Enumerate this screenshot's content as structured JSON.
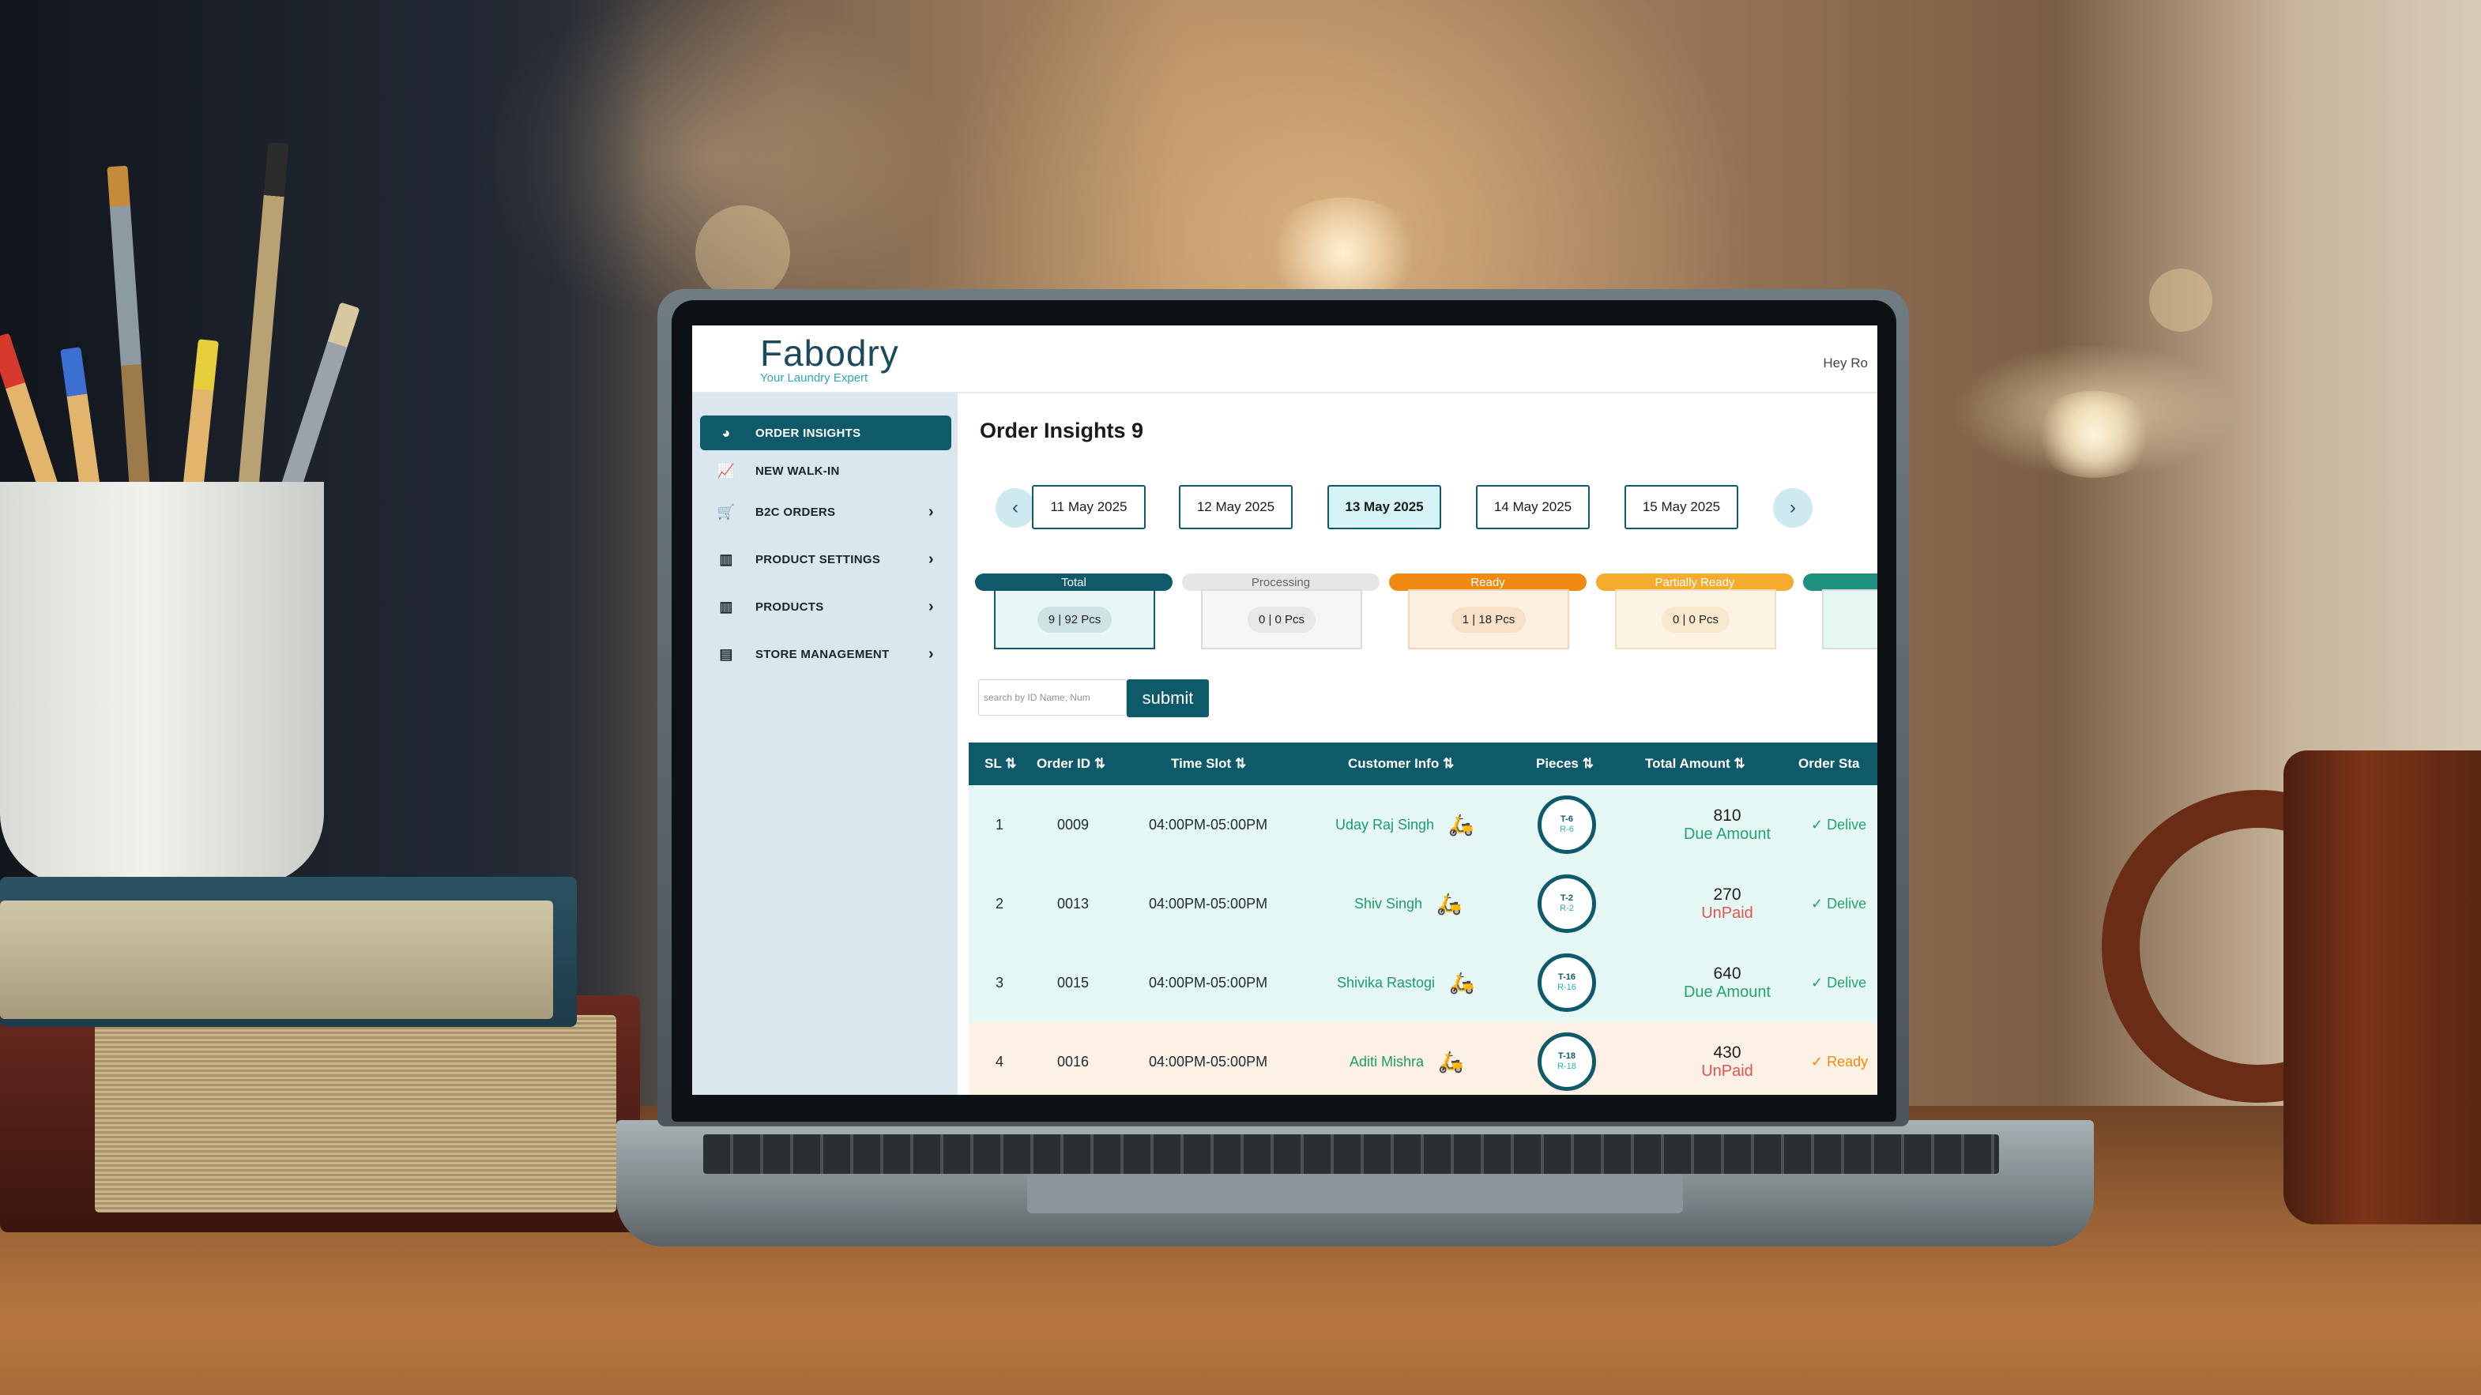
{
  "brand": {
    "name": "Fabodry",
    "tagline": "Your Laundry Expert"
  },
  "header": {
    "greeting": "Hey Ro"
  },
  "sidebar": {
    "items": [
      {
        "label": "ORDER INSIGHTS",
        "icon": "pie-chart-icon",
        "active": true,
        "chevron": false
      },
      {
        "label": "NEW WALK-IN",
        "icon": "line-chart-icon",
        "active": false,
        "chevron": false
      },
      {
        "label": "B2C ORDERS",
        "icon": "cart-icon",
        "active": false,
        "chevron": true
      },
      {
        "label": "PRODUCT SETTINGS",
        "icon": "map-icon",
        "active": false,
        "chevron": true
      },
      {
        "label": "PRODUCTS",
        "icon": "map-icon",
        "active": false,
        "chevron": true
      },
      {
        "label": "STORE MANAGEMENT",
        "icon": "store-icon",
        "active": false,
        "chevron": true
      }
    ]
  },
  "main": {
    "title": "Order Insights 9",
    "dates": [
      "11 May 2025",
      "12 May 2025",
      "13 May 2025",
      "14 May 2025",
      "15 May 2025"
    ],
    "selected_date": "13 May 2025",
    "statuses": [
      {
        "label": "Total",
        "count": "9 | 92 Pcs",
        "color": "#0e5a6a"
      },
      {
        "label": "Processing",
        "count": "0 | 0 Pcs",
        "color": "#e6e6e6"
      },
      {
        "label": "Ready",
        "count": "1 | 18 Pcs",
        "color": "#ef8a12"
      },
      {
        "label": "Partially Ready",
        "count": "0 | 0 Pcs",
        "color": "#f5ab2e"
      }
    ],
    "search": {
      "placeholder": "search by ID Name, Num",
      "submit_label": "submit"
    },
    "table": {
      "headers": [
        "SL ⇅",
        "Order ID ⇅",
        "Time Slot ⇅",
        "Customer Info ⇅",
        "Pieces ⇅",
        "Total Amount ⇅",
        "Order Sta"
      ],
      "rows": [
        {
          "sl": "1",
          "order_id": "0009",
          "time_slot": "04:00PM-05:00PM",
          "customer": "Uday Raj Singh",
          "pieces_t": "T-6",
          "pieces_r": "R-6",
          "amount": "810",
          "payment": "Due Amount",
          "status": "Delive"
        },
        {
          "sl": "2",
          "order_id": "0013",
          "time_slot": "04:00PM-05:00PM",
          "customer": "Shiv Singh",
          "pieces_t": "T-2",
          "pieces_r": "R-2",
          "amount": "270",
          "payment": "UnPaid",
          "status": "Delive"
        },
        {
          "sl": "3",
          "order_id": "0015",
          "time_slot": "04:00PM-05:00PM",
          "customer": "Shivika Rastogi",
          "pieces_t": "T-16",
          "pieces_r": "R-16",
          "amount": "640",
          "payment": "Due Amount",
          "status": "Delive"
        },
        {
          "sl": "4",
          "order_id": "0016",
          "time_slot": "04:00PM-05:00PM",
          "customer": "Aditi Mishra",
          "pieces_t": "T-18",
          "pieces_r": "R-18",
          "amount": "430",
          "payment": "UnPaid",
          "status": "Ready"
        }
      ]
    }
  }
}
